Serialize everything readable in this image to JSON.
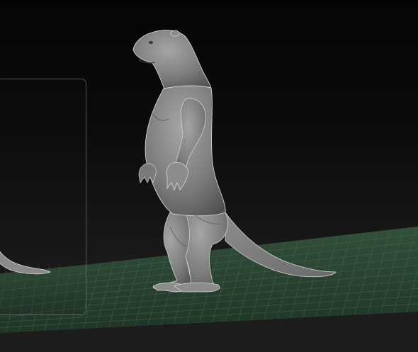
{
  "viewport": {
    "background_color": "#0a0a0a",
    "floor_color": "#2e4a35",
    "grid_line_color": "#4f6d55",
    "model_color": "#8a8a8a"
  },
  "scene": {
    "model_icon": "otter-sculpt-icon",
    "floor_icon": "grid-floor-icon"
  },
  "inset_panel": {
    "icon": "tail-preview-icon"
  }
}
